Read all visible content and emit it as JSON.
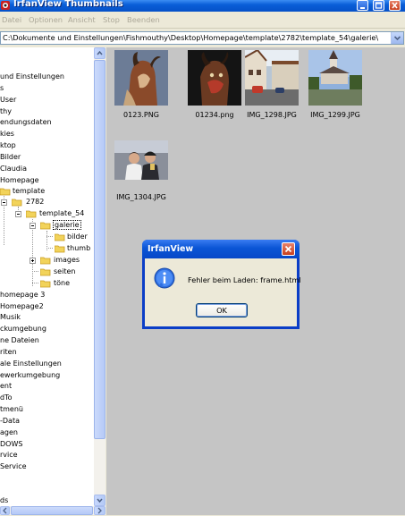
{
  "window": {
    "title": "IrfanView Thumbnails"
  },
  "menu": [
    "Datei",
    "Optionen",
    "Ansicht",
    "Stop",
    "Beenden"
  ],
  "path": "C:\\Dokumente und Einstellungen\\Fishmouthy\\Desktop\\Homepage\\template\\2782\\template_54\\galerie\\",
  "tree": [
    "und Einstellungen",
    "s",
    "User",
    "thy",
    "endungsdaten",
    "kies",
    "ktop",
    "Bilder",
    "Claudia",
    "Homepage",
    "template",
    "2782",
    "template_54",
    "galerie",
    "bilder",
    "thumb",
    "images",
    "seiten",
    "töne",
    "homepage 3",
    "Homepage2",
    "Musik",
    "ckumgebung",
    "ne Dateien",
    "riten",
    "ale Einstellungen",
    "ewerkumgebung",
    "ent",
    "dTo",
    "tmenü",
    "-Data",
    "agen",
    "DOWS",
    "rvice",
    "Service",
    "ds"
  ],
  "thumbnails": [
    {
      "name": "0123.PNG",
      "icon": "photo-mask-1"
    },
    {
      "name": "01234.png",
      "icon": "photo-mask-2"
    },
    {
      "name": "IMG_1298.JPG",
      "icon": "photo-street"
    },
    {
      "name": "IMG_1299.JPG",
      "icon": "photo-church"
    },
    {
      "name": "IMG_1304.JPG",
      "icon": "photo-couple"
    }
  ],
  "dialog": {
    "title": "IrfanView",
    "message": "Fehler beim Laden: frame.html",
    "ok_label": "OK",
    "icon": "info-icon"
  },
  "colors": {
    "titlebar": "#0a5fd8",
    "pane_bg": "#c5c5c5",
    "dialog_border": "#0b3ec7"
  }
}
